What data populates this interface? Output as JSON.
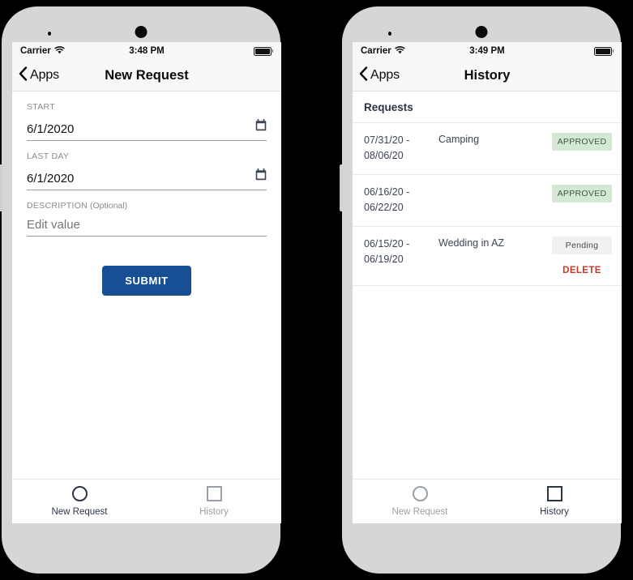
{
  "phones": [
    {
      "id": "left",
      "status_bar": {
        "carrier": "Carrier",
        "time": "3:48 PM",
        "wifi_icon": "wifi-icon",
        "battery_icon": "battery-full-icon"
      },
      "nav": {
        "back_label": "Apps",
        "back_icon": "chevron-left-icon",
        "title": "New Request"
      },
      "form": {
        "fields": [
          {
            "label": "START",
            "optional_suffix": "",
            "value": "6/1/2020",
            "placeholder": "",
            "icon": "calendar-icon"
          },
          {
            "label": "LAST DAY",
            "optional_suffix": "",
            "value": "6/1/2020",
            "placeholder": "",
            "icon": "calendar-icon"
          },
          {
            "label": "DESCRIPTION",
            "optional_suffix": " (Optional)",
            "value": "",
            "placeholder": "Edit value",
            "icon": ""
          }
        ],
        "submit_label": "SUBMIT",
        "submit_color": "#174f95"
      },
      "tabs": [
        {
          "label": "New Request",
          "icon": "circle-icon",
          "active": true
        },
        {
          "label": "History",
          "icon": "square-icon",
          "active": false
        }
      ]
    },
    {
      "id": "right",
      "status_bar": {
        "carrier": "Carrier",
        "time": "3:49 PM",
        "wifi_icon": "wifi-icon",
        "battery_icon": "battery-full-icon"
      },
      "nav": {
        "back_label": "Apps",
        "back_icon": "chevron-left-icon",
        "title": "History"
      },
      "list": {
        "header": "Requests",
        "rows": [
          {
            "dates": "07/31/20 - 08/06/20",
            "title": "Camping",
            "status": "APPROVED",
            "status_kind": "approved",
            "status_bg": "#d5e8d4",
            "delete_label": ""
          },
          {
            "dates": "06/16/20 - 06/22/20",
            "title": "",
            "status": "APPROVED",
            "status_kind": "approved",
            "status_bg": "#d5e8d4",
            "delete_label": ""
          },
          {
            "dates": "06/15/20 - 06/19/20",
            "title": "Wedding in AZ",
            "status": "Pending",
            "status_kind": "pending",
            "status_bg": "#f1f1f1",
            "delete_label": "DELETE"
          }
        ],
        "delete_color": "#c0392b"
      },
      "tabs": [
        {
          "label": "New Request",
          "icon": "circle-icon",
          "active": false
        },
        {
          "label": "History",
          "icon": "square-icon",
          "active": true
        }
      ]
    }
  ]
}
